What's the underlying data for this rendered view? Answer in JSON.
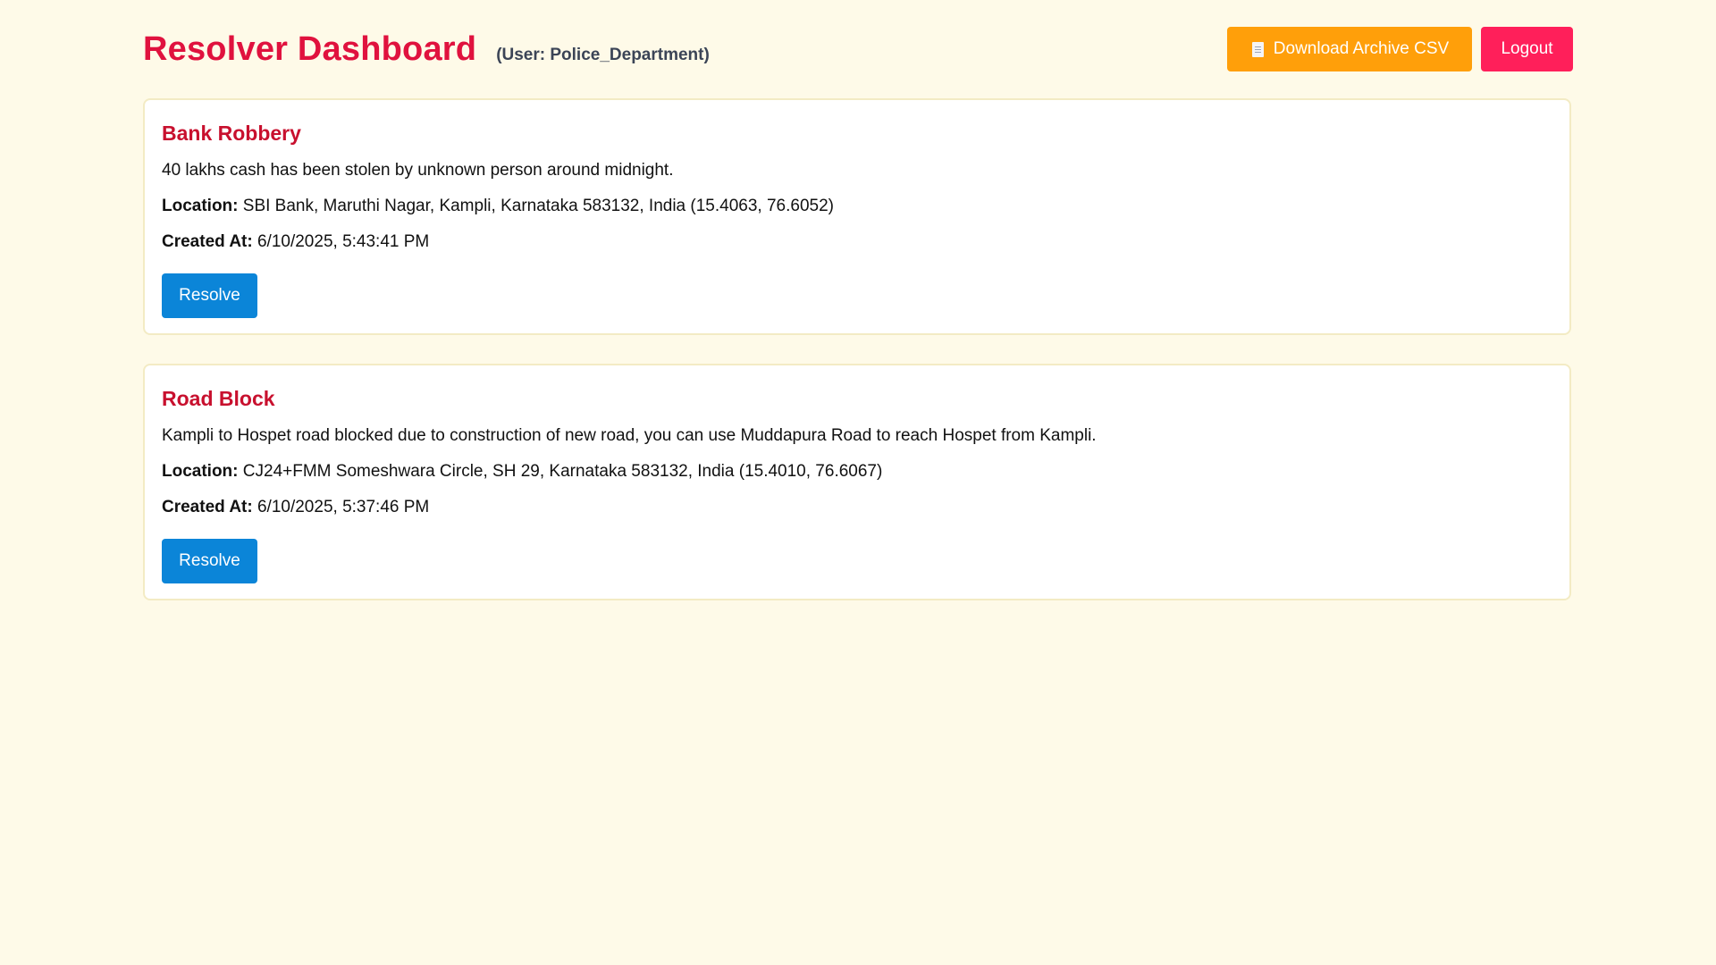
{
  "header": {
    "title": "Resolver Dashboard",
    "user_label": "(User: Police_Department)",
    "download_label": "Download Archive CSV",
    "download_icon": "document-icon",
    "logout_label": "Logout"
  },
  "colors": {
    "background": "#fefae8",
    "title": "#e0123e",
    "card_title": "#c8102e",
    "download_button": "#ff9f0a",
    "logout_button": "#ff1f5a",
    "resolve_button": "#0b85d8"
  },
  "incidents": [
    {
      "title": "Bank Robbery",
      "description": "40 lakhs cash has been stolen by unknown person around midnight.",
      "location_label": "Location:",
      "location": "SBI Bank, Maruthi Nagar, Kampli, Karnataka 583132, India (15.4063, 76.6052)",
      "created_label": "Created At:",
      "created_at": "6/10/2025, 5:43:41 PM",
      "action_label": "Resolve"
    },
    {
      "title": "Road Block",
      "description": "Kampli to Hospet road blocked due to construction of new road, you can use Muddapura Road to reach Hospet from Kampli.",
      "location_label": "Location:",
      "location": "CJ24+FMM Someshwara Circle, SH 29, Karnataka 583132, India (15.4010, 76.6067)",
      "created_label": "Created At:",
      "created_at": "6/10/2025, 5:37:46 PM",
      "action_label": "Resolve"
    }
  ]
}
